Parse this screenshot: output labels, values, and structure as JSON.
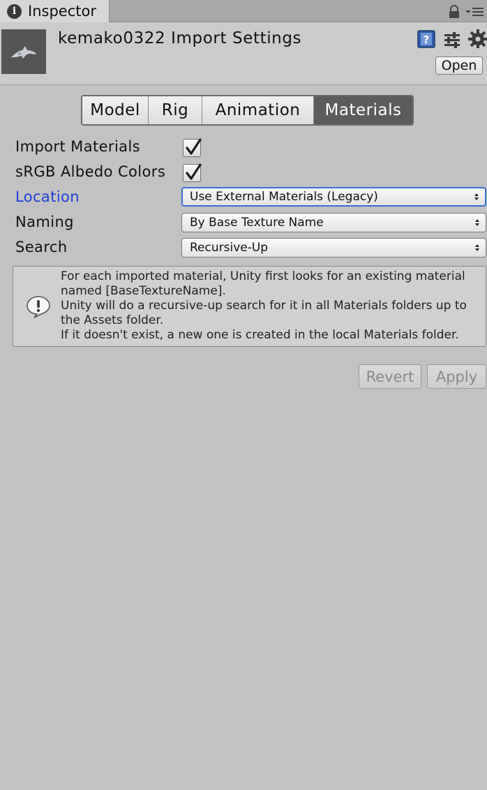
{
  "tab": {
    "title": "Inspector",
    "icon": "info-icon"
  },
  "header": {
    "title": "kemako0322 Import Settings",
    "open_label": "Open"
  },
  "toolbar": {
    "tabs": [
      {
        "label": "Model",
        "active": false
      },
      {
        "label": "Rig",
        "active": false
      },
      {
        "label": "Animation",
        "active": false
      },
      {
        "label": "Materials",
        "active": true
      }
    ]
  },
  "properties": {
    "import_materials": {
      "label": "Import Materials",
      "checked": true
    },
    "srgb_albedo": {
      "label": "sRGB Albedo Colors",
      "checked": true
    },
    "location": {
      "label": "Location",
      "value": "Use External Materials (Legacy)"
    },
    "naming": {
      "label": "Naming",
      "value": "By Base Texture Name"
    },
    "search": {
      "label": "Search",
      "value": "Recursive-Up"
    }
  },
  "help": {
    "lines": [
      "For each imported material, Unity first looks for an existing material",
      "named [BaseTextureName].",
      "Unity will do a recursive-up search for it in all Materials folders up to",
      "the Assets folder.",
      "If it doesn't exist, a new one is created in the local Materials folder."
    ]
  },
  "actions": {
    "revert_label": "Revert",
    "apply_label": "Apply"
  },
  "colors": {
    "background": "#c2c2c2",
    "active_tab": "#5c5c5c",
    "modified_label": "#1f3fd6",
    "focus_border": "#3b6fd6"
  }
}
